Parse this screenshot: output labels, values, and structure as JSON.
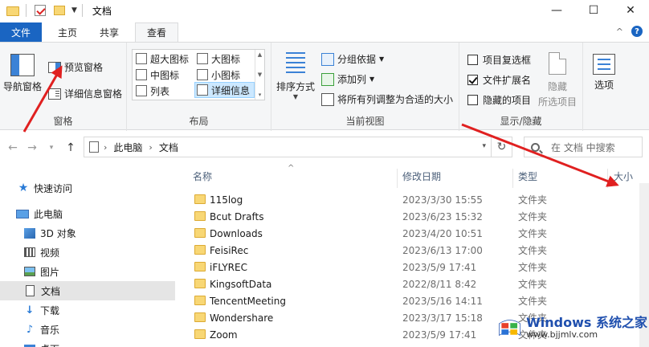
{
  "window": {
    "title": "文档",
    "controls": {
      "minimize": "—",
      "maximize": "☐",
      "close": "✕"
    }
  },
  "ribbon_tabs": [
    {
      "label": "文件"
    },
    {
      "label": "主页"
    },
    {
      "label": "共享"
    },
    {
      "label": "查看"
    }
  ],
  "active_tab": "查看",
  "ribbon": {
    "panes": {
      "label": "窗格",
      "nav_pane": "导航窗格",
      "preview_pane": "预览窗格",
      "details_pane": "详细信息窗格"
    },
    "layout": {
      "label": "布局",
      "items": [
        {
          "label": "超大图标",
          "selected": false
        },
        {
          "label": "大图标",
          "selected": false
        },
        {
          "label": "中图标",
          "selected": false
        },
        {
          "label": "小图标",
          "selected": false
        },
        {
          "label": "列表",
          "selected": false
        },
        {
          "label": "详细信息",
          "selected": true
        }
      ]
    },
    "current_view": {
      "label": "当前视图",
      "sort_by": "排序方式",
      "group_by": "分组依据",
      "add_column": "添加列",
      "size_all_columns": "将所有列调整为合适的大小"
    },
    "show_hide": {
      "label": "显示/隐藏",
      "item_checkboxes": {
        "label": "项目复选框",
        "checked": false
      },
      "file_extensions": {
        "label": "文件扩展名",
        "checked": true
      },
      "hidden_items": {
        "label": "隐藏的项目",
        "checked": false
      },
      "hide_selected_line1": "隐藏",
      "hide_selected_line2": "所选项目"
    },
    "options": {
      "label": "选项"
    }
  },
  "address": {
    "crumbs": [
      "此电脑",
      "文档"
    ],
    "search_placeholder": "在 文档 中搜索"
  },
  "nav_pane": {
    "items": [
      {
        "label": "快速访问",
        "icon": "star-icon"
      },
      {
        "label": "此电脑",
        "icon": "computer-icon"
      },
      {
        "label": "3D 对象",
        "icon": "3d-objects-icon"
      },
      {
        "label": "视频",
        "icon": "video-icon"
      },
      {
        "label": "图片",
        "icon": "pictures-icon"
      },
      {
        "label": "文档",
        "icon": "documents-icon",
        "selected": true
      },
      {
        "label": "下载",
        "icon": "download-icon"
      },
      {
        "label": "音乐",
        "icon": "music-icon"
      },
      {
        "label": "桌面",
        "icon": "desktop-icon"
      }
    ]
  },
  "file_list": {
    "columns": {
      "name": "名称",
      "date": "修改日期",
      "type": "类型",
      "size": "大小"
    },
    "rows": [
      {
        "name": "115log",
        "date": "2023/3/30 15:55",
        "type": "文件夹"
      },
      {
        "name": "Bcut Drafts",
        "date": "2023/6/23 15:32",
        "type": "文件夹"
      },
      {
        "name": "Downloads",
        "date": "2023/4/20 10:51",
        "type": "文件夹"
      },
      {
        "name": "FeisiRec",
        "date": "2023/6/13 17:00",
        "type": "文件夹"
      },
      {
        "name": "iFLYREC",
        "date": "2023/5/9 17:41",
        "type": "文件夹"
      },
      {
        "name": "KingsoftData",
        "date": "2022/8/11 8:42",
        "type": "文件夹"
      },
      {
        "name": "TencentMeeting",
        "date": "2023/5/16 14:11",
        "type": "文件夹"
      },
      {
        "name": "Wondershare",
        "date": "2023/3/17 15:18",
        "type": "文件夹"
      },
      {
        "name": "Zoom",
        "date": "2023/5/9 17:41",
        "type": "文件夹"
      }
    ]
  },
  "watermark": {
    "title": "Windows 系统之家",
    "url": "www.bjjmlv.com"
  },
  "colors": {
    "file_tab": "#1a65c2",
    "folder": "#f8d775",
    "annotation_arrow": "#e02020",
    "watermark": "#1f4fae"
  }
}
